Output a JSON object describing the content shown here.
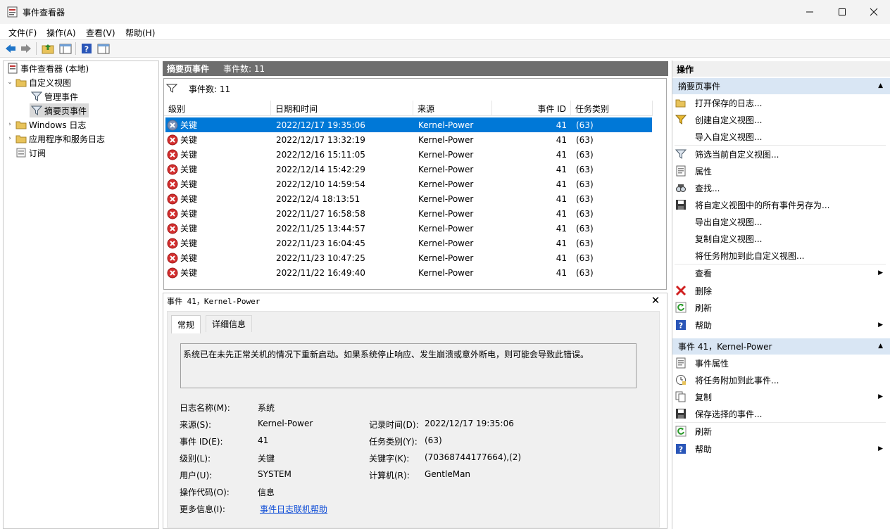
{
  "window": {
    "title": "事件查看器"
  },
  "menu": [
    "文件(F)",
    "操作(A)",
    "查看(V)",
    "帮助(H)"
  ],
  "tree": {
    "root": "事件查看器 (本地)",
    "custom_views": "自定义视图",
    "admin_events": "管理事件",
    "summary_events": "摘要页事件",
    "windows_logs": "Windows 日志",
    "app_service_logs": "应用程序和服务日志",
    "subscriptions": "订阅"
  },
  "middle": {
    "header_title": "摘要页事件",
    "header_count": "事件数: 11",
    "filter_text": "事件数:  11",
    "columns": [
      "级别",
      "日期和时间",
      "来源",
      "事件 ID",
      "任务类别"
    ],
    "rows": [
      {
        "level": "关键",
        "datetime": "2022/12/17 19:35:06",
        "source": "Kernel-Power",
        "id": "41",
        "category": "(63)"
      },
      {
        "level": "关键",
        "datetime": "2022/12/17 13:32:19",
        "source": "Kernel-Power",
        "id": "41",
        "category": "(63)"
      },
      {
        "level": "关键",
        "datetime": "2022/12/16 15:11:05",
        "source": "Kernel-Power",
        "id": "41",
        "category": "(63)"
      },
      {
        "level": "关键",
        "datetime": "2022/12/14 15:42:29",
        "source": "Kernel-Power",
        "id": "41",
        "category": "(63)"
      },
      {
        "level": "关键",
        "datetime": "2022/12/10 14:59:54",
        "source": "Kernel-Power",
        "id": "41",
        "category": "(63)"
      },
      {
        "level": "关键",
        "datetime": "2022/12/4 18:13:51",
        "source": "Kernel-Power",
        "id": "41",
        "category": "(63)"
      },
      {
        "level": "关键",
        "datetime": "2022/11/27 16:58:58",
        "source": "Kernel-Power",
        "id": "41",
        "category": "(63)"
      },
      {
        "level": "关键",
        "datetime": "2022/11/25 13:44:57",
        "source": "Kernel-Power",
        "id": "41",
        "category": "(63)"
      },
      {
        "level": "关键",
        "datetime": "2022/11/23 16:04:45",
        "source": "Kernel-Power",
        "id": "41",
        "category": "(63)"
      },
      {
        "level": "关键",
        "datetime": "2022/11/23 10:47:25",
        "source": "Kernel-Power",
        "id": "41",
        "category": "(63)"
      },
      {
        "level": "关键",
        "datetime": "2022/11/22 16:49:40",
        "source": "Kernel-Power",
        "id": "41",
        "category": "(63)"
      }
    ]
  },
  "detail": {
    "title": "事件 41，Kernel-Power",
    "tabs": [
      "常规",
      "详细信息"
    ],
    "message": "系统已在未先正常关机的情况下重新启动。如果系统停止响应、发生崩溃或意外断电，则可能会导致此错误。",
    "props": {
      "log_name_label": "日志名称(M):",
      "log_name": "系统",
      "source_label": "来源(S):",
      "source": "Kernel-Power",
      "logged_label": "记录时间(D):",
      "logged": "2022/12/17 19:35:06",
      "event_id_label": "事件 ID(E):",
      "event_id": "41",
      "task_label": "任务类别(Y):",
      "task": "(63)",
      "level_label": "级别(L):",
      "level": "关键",
      "keywords_label": "关键字(K):",
      "keywords": "(70368744177664),(2)",
      "user_label": "用户(U):",
      "user": "SYSTEM",
      "computer_label": "计算机(R):",
      "computer": "GentleMan",
      "opcode_label": "操作代码(O):",
      "opcode": "信息",
      "more_info_label": "更多信息(I):",
      "more_info_link": "事件日志联机帮助"
    }
  },
  "actions": {
    "header": "操作",
    "section1": "摘要页事件",
    "items1": [
      "打开保存的日志...",
      "创建自定义视图...",
      "导入自定义视图...",
      "筛选当前自定义视图...",
      "属性",
      "查找...",
      "将自定义视图中的所有事件另存为...",
      "导出自定义视图...",
      "复制自定义视图...",
      "将任务附加到此自定义视图...",
      "查看",
      "删除",
      "刷新",
      "帮助"
    ],
    "section2": "事件 41，Kernel-Power",
    "items2": [
      "事件属性",
      "将任务附加到此事件...",
      "复制",
      "保存选择的事件...",
      "刷新",
      "帮助"
    ]
  },
  "colors": {
    "selection": "#0078d7",
    "section_bg": "#d9e6f4",
    "error_red": "#d32f2f",
    "link": "#0b4ad6"
  }
}
